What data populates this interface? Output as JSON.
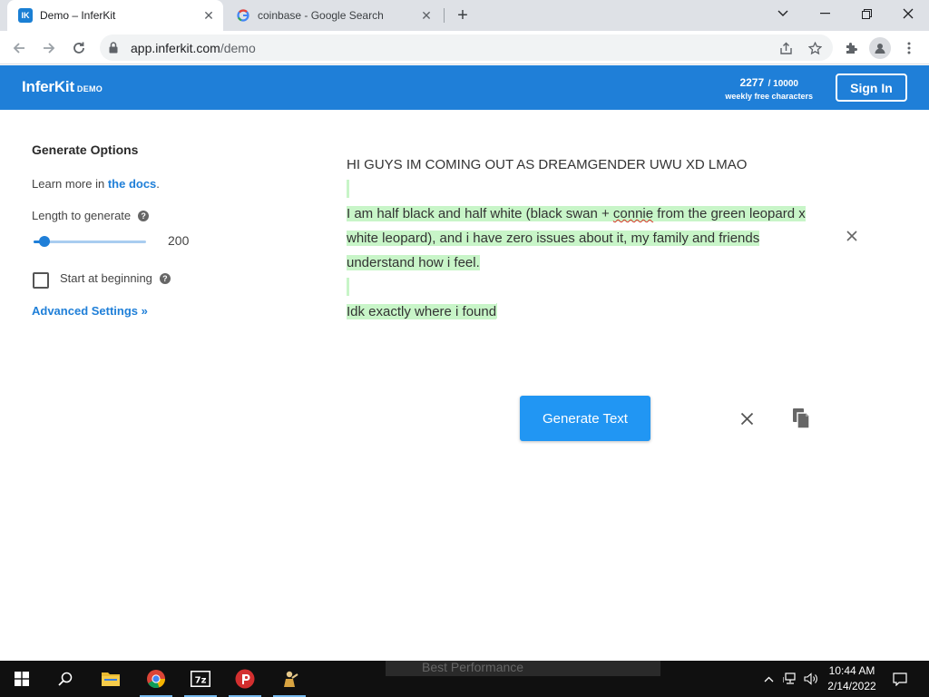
{
  "browser": {
    "tabs": [
      {
        "title": "Demo – InferKit",
        "favicon": "inferkit-favicon",
        "favicon_text": "IK",
        "active": true
      },
      {
        "title": "coinbase - Google Search",
        "favicon": "google-favicon",
        "active": false
      }
    ],
    "url_host": "app.inferkit.com",
    "url_path": "/demo"
  },
  "header": {
    "brand": "InferKit",
    "brand_tag": "DEMO",
    "quota_used": "2277",
    "quota_max": "/ 10000",
    "quota_label": "weekly free characters",
    "signin_label": "Sign In"
  },
  "options": {
    "title": "Generate Options",
    "learn_prefix": "Learn more in ",
    "learn_link": "the docs",
    "learn_suffix": ".",
    "length_label": "Length to generate",
    "length_value": "200",
    "length_fraction": 0.1,
    "start_label": "Start at beginning",
    "start_checked": false,
    "advanced_label": "Advanced Settings »",
    "help_glyph": "?"
  },
  "editor": {
    "prompt": "HI GUYS IM COMING OUT AS DREAMGENDER UWU XD LMAO",
    "gen_line1_a": "I am half black and half white (black swan + ",
    "gen_line1_misspelled": "connie",
    "gen_line1_b": " from the green leopard x white leopard), and i have zero issues about it, my family and friends understand how i feel.",
    "gen_line2": "Idk exactly where i found"
  },
  "actions": {
    "generate_label": "Generate Text"
  },
  "taskbar": {
    "ghost_text": "Best Performance",
    "time": "10:44 AM",
    "date": "2/14/2022"
  },
  "colors": {
    "brand_blue": "#1f7fd8",
    "generate_button": "#2196f3",
    "generated_highlight": "#c8f5c8"
  }
}
